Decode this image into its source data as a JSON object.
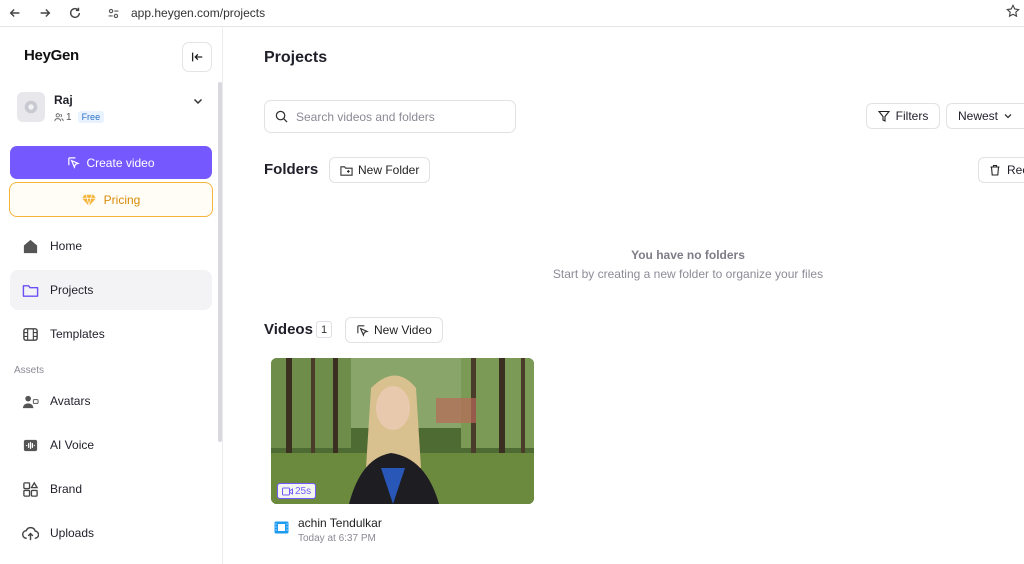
{
  "browser": {
    "url": "app.heygen.com/projects"
  },
  "sidebar": {
    "logo": "HeyGen",
    "account": {
      "name": "Raj",
      "members": "1",
      "plan": "Free"
    },
    "create_label": "Create video",
    "pricing_label": "Pricing",
    "assets_label": "Assets",
    "items": [
      {
        "label": "Home",
        "icon": "home-icon"
      },
      {
        "label": "Projects",
        "icon": "folder-icon"
      },
      {
        "label": "Templates",
        "icon": "templates-icon"
      },
      {
        "label": "Avatars",
        "icon": "avatar-icon"
      },
      {
        "label": "AI Voice",
        "icon": "voice-icon"
      },
      {
        "label": "Brand",
        "icon": "brand-icon"
      },
      {
        "label": "Uploads",
        "icon": "upload-icon"
      }
    ]
  },
  "main": {
    "title": "Projects",
    "search_placeholder": "Search videos and folders",
    "filters_label": "Filters",
    "sort_label": "Newest",
    "folders": {
      "title": "Folders",
      "new_label": "New Folder",
      "recycle_label": "Recently Deleted",
      "empty_title": "You have no folders",
      "empty_subtitle": "Start by creating a new folder to organize your files"
    },
    "videos": {
      "title": "Videos",
      "count": "1",
      "new_label": "New Video",
      "items": [
        {
          "title": "achin Tendulkar",
          "time": "Today at 6:37 PM",
          "duration": "25s"
        }
      ]
    }
  },
  "colors": {
    "accent": "#7559ff",
    "pricing": "#f5b53b"
  }
}
